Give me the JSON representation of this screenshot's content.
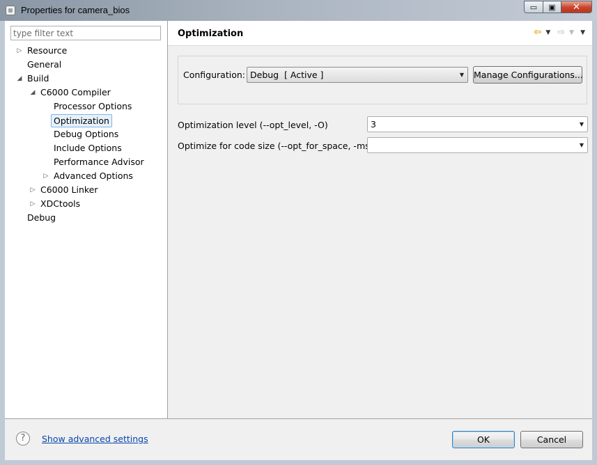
{
  "window": {
    "title": "Properties for camera_bios",
    "minimize_glyph": "▭",
    "maximize_glyph": "▣",
    "close_glyph": "✕"
  },
  "filter": {
    "placeholder": "type filter text",
    "value": ""
  },
  "tree": {
    "resource": "Resource",
    "general": "General",
    "build": "Build",
    "c6000_compiler": "C6000 Compiler",
    "processor_options": "Processor Options",
    "optimization": "Optimization",
    "debug_options": "Debug Options",
    "include_options": "Include Options",
    "performance_advisor": "Performance Advisor",
    "advanced_options": "Advanced Options",
    "c6000_linker": "C6000 Linker",
    "xdctools": "XDCtools",
    "debug": "Debug",
    "collapsed_glyph": "▷",
    "expanded_glyph": "◢"
  },
  "page": {
    "title": "Optimization",
    "nav": {
      "back_glyph": "⇦",
      "forward_glyph": "⇨",
      "dropdown_glyph": "▼",
      "menu_glyph": "▼"
    }
  },
  "config": {
    "label": "Configuration:",
    "value": "Debug  [ Active ]",
    "manage_button": "Manage Configurations..."
  },
  "options": {
    "opt_level_label": "Optimization level (--opt_level, -O)",
    "opt_level_value": "3",
    "opt_space_label": "Optimize for code size (--opt_for_space, -ms)",
    "opt_space_value": ""
  },
  "combo_arrow": "▼",
  "footer": {
    "help_glyph": "?",
    "advanced_link": "Show advanced settings",
    "ok": "OK",
    "cancel": "Cancel"
  },
  "colors": {
    "link": "#0645ad",
    "selection_border": "#7eb4ea",
    "selection_fill": "#e5f1fb",
    "close_button": "#c7432a"
  }
}
